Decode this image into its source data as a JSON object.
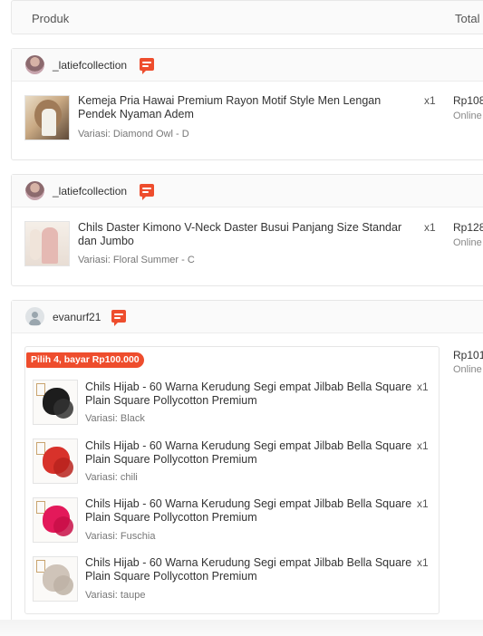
{
  "table_header": {
    "produk": "Produk",
    "total": "Total"
  },
  "shops": [
    {
      "name": "_latiefcollection",
      "items": [
        {
          "title": "Kemeja Pria Hawai Premium Rayon Motif Style Men Lengan Pendek Nyaman Adem",
          "variant": "Variasi: Diamond Owl - D",
          "qty": "x1",
          "price": "Rp108",
          "payment": "Online"
        }
      ]
    },
    {
      "name": "_latiefcollection",
      "items": [
        {
          "title": "Chils Daster Kimono V-Neck Daster Busui Panjang Size Standar dan Jumbo",
          "variant": "Variasi: Floral Summer - C",
          "qty": "x1",
          "price": "Rp128",
          "payment": "Online"
        }
      ]
    },
    {
      "name": "evanurf21",
      "bundle_badge": "Pilih 4, bayar Rp100.000",
      "price": "Rp101",
      "payment": "Online",
      "items": [
        {
          "title": "Chils Hijab - 60 Warna Kerudung Segi empat Jilbab Bella Square Plain Square Pollycotton Premium",
          "variant": "Variasi: Black",
          "qty": "x1",
          "color": "#1d1d1d"
        },
        {
          "title": "Chils Hijab - 60 Warna Kerudung Segi empat Jilbab Bella Square Plain Square Pollycotton Premium",
          "variant": "Variasi: chili",
          "qty": "x1",
          "color": "#d8322b"
        },
        {
          "title": "Chils Hijab - 60 Warna Kerudung Segi empat Jilbab Bella Square Plain Square Pollycotton Premium",
          "variant": "Variasi: Fuschia",
          "qty": "x1",
          "color": "#e3195a"
        },
        {
          "title": "Chils Hijab - 60 Warna Kerudung Segi empat Jilbab Bella Square Plain Square Pollycotton Premium",
          "variant": "Variasi: taupe",
          "qty": "x1",
          "color": "#cfc4b9"
        }
      ]
    }
  ],
  "colors": {
    "accent": "#ee4d2d"
  }
}
